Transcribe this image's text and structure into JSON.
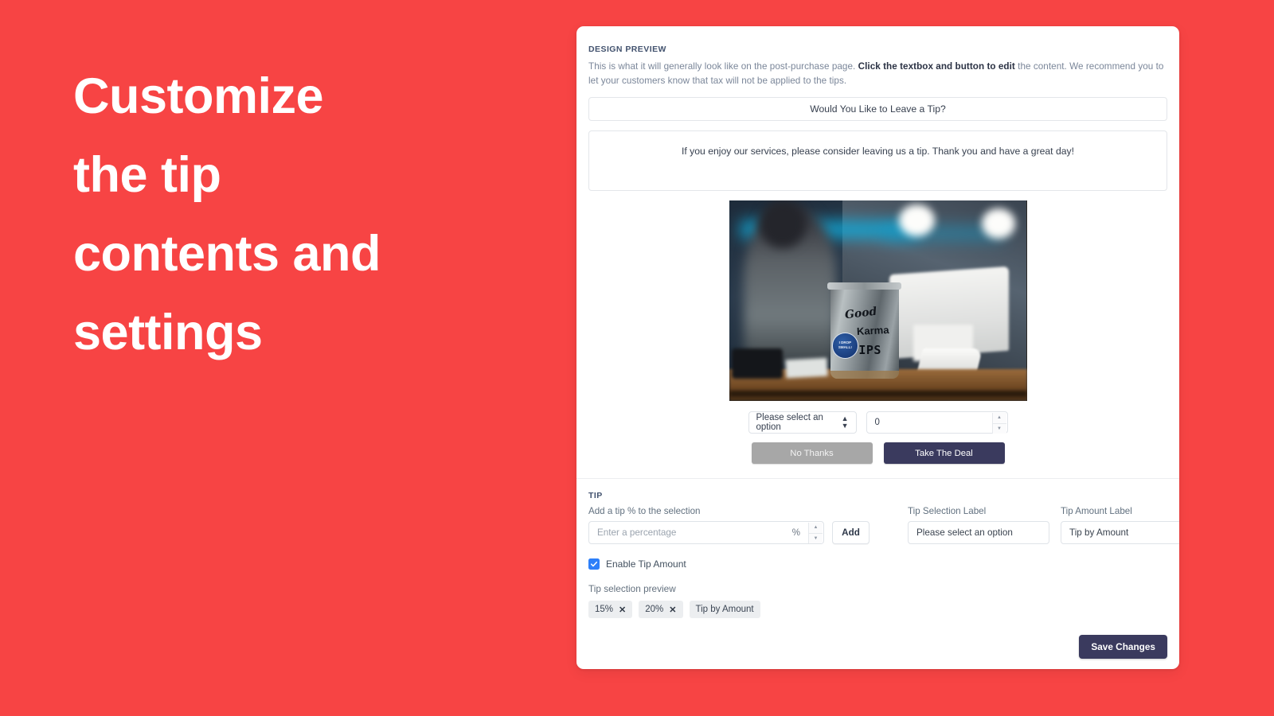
{
  "theme": {
    "background": "#f74444",
    "card_background": "#ffffff",
    "primary_button": "#3a3a5e",
    "secondary_button": "#a7a7a7",
    "checkbox_accent": "#2d7ff9"
  },
  "headline": {
    "lines": [
      "Customize",
      "the tip",
      "contents and",
      "settings"
    ]
  },
  "preview": {
    "eyebrow": "DESIGN PREVIEW",
    "description_part1": "This is what it will generally look like on the post-purchase page. ",
    "description_bold": "Click the textbox and button to edit",
    "description_part2": " the content. We recommend you to let your customers know that tax will not be applied to the tips.",
    "title_text": "Would You Like to Leave a Tip?",
    "body_text": "If you enjoy our services, please consider leaving us a tip. Thank you and have a great day!",
    "image_alt": "tip-jar-on-counter",
    "image_text": {
      "good": "Good",
      "karma": "Karma",
      "tips": "TIPS",
      "badge": "I DROP SMALL!"
    },
    "select_value": "Please select an option",
    "amount_value": "0",
    "decline_button": "No Thanks",
    "accept_button": "Take The Deal"
  },
  "tip": {
    "eyebrow": "TIP",
    "percent_label": "Add a tip % to the selection",
    "percent_placeholder": "Enter a percentage",
    "percent_suffix": "%",
    "add_button": "Add",
    "selection_label_title": "Tip Selection Label",
    "selection_label_value": "Please select an option",
    "amount_label_title": "Tip Amount Label",
    "amount_label_value": "Tip by Amount",
    "enable_checkbox_label": "Enable Tip Amount",
    "enable_checkbox_checked": true,
    "selection_preview_label": "Tip selection preview",
    "pills": [
      {
        "label": "15%",
        "removable": true,
        "remove_icon": "✕"
      },
      {
        "label": "20%",
        "removable": true,
        "remove_icon": "✕"
      },
      {
        "label": "Tip by Amount",
        "removable": false,
        "remove_icon": ""
      }
    ]
  },
  "footer": {
    "save_button": "Save Changes"
  }
}
